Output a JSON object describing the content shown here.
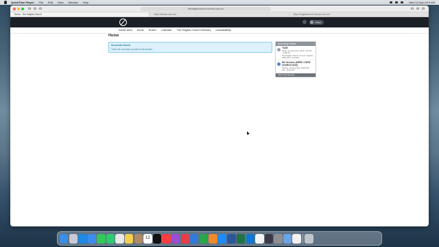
{
  "menubar": {
    "app_name": "QuickTime Player",
    "items": [
      "File",
      "Edit",
      "View",
      "Window",
      "Help"
    ],
    "clock": "Wed 12 Nov 8:19 AM"
  },
  "browser": {
    "address": "theheightschurch.elvanto.com.au",
    "tabs": [
      {
        "title": "Home - The Heights Church",
        "active": true
      },
      {
        "title": "https://elvanto.com.au/..."
      },
      {
        "title": "https://heightschurch.elvanto.com.au/..."
      }
    ]
  },
  "site": {
    "user_name": "Office",
    "nav": [
      "Admin Area",
      "Home",
      "Roster",
      "Calendar",
      "The Heights Church Directory",
      "Unavailability"
    ],
    "page_title": "Home",
    "alert": {
      "title": "No posts found",
      "body": "There are currently no posts in this section."
    },
    "events": {
      "header": "Upcoming Events",
      "items": [
        {
          "name": "TUNE",
          "meta1": "Friday, 14 November, 2025 7:30 PM",
          "meta2": "- 9:00 PM",
          "meta3": "The Heights Church, Hermon Heights,",
          "meta4": "NSW 2071, Australia",
          "icon": "gray"
        },
        {
          "name": "Hill Services (WEEK 4 NEW",
          "meta1": "CHURCH 2025)",
          "meta2": "Sunday, 16 November, 2025 8:30",
          "meta3": "AM - 12:00 PM",
          "meta4": "",
          "icon": "blue"
        }
      ],
      "footer": "View Full Calendar"
    }
  },
  "dock": {
    "calendar_day": "12",
    "icons": [
      "finder-icon",
      "launchpad-icon",
      "safari-icon",
      "mail-icon",
      "messages-icon",
      "facetime-icon",
      "photos-icon",
      "notes-icon",
      "contacts-icon",
      "calendar-icon",
      "appletv-icon",
      "music-icon",
      "podcasts-icon",
      "news-icon",
      "keynote-icon",
      "numbers-icon",
      "pages-icon",
      "appstore-icon",
      "word-icon",
      "excel-icon",
      "outlook-icon",
      "chrome-icon",
      "quicktime-icon",
      "settings-icon",
      "preview-icon",
      "textedit-icon",
      "trash-icon"
    ],
    "colors": [
      "#3a8ee6",
      "#c9c9d6",
      "#1e88e5",
      "#3f8cf0",
      "#34c759",
      "#2ecc71",
      "#e8e8e8",
      "#f6d04d",
      "#b08a62",
      "#ffffff",
      "#111111",
      "#fc3c44",
      "#9b4dd6",
      "#e93e4a",
      "#2f7bd8",
      "#27a94a",
      "#ef8a2a",
      "#1a8cff",
      "#2b579a",
      "#217346",
      "#0f78d4",
      "#f4f4f4",
      "#3a3a46",
      "#8e8e93",
      "#6aa4e8",
      "#f2f2f2",
      "#bfc5cb"
    ]
  }
}
